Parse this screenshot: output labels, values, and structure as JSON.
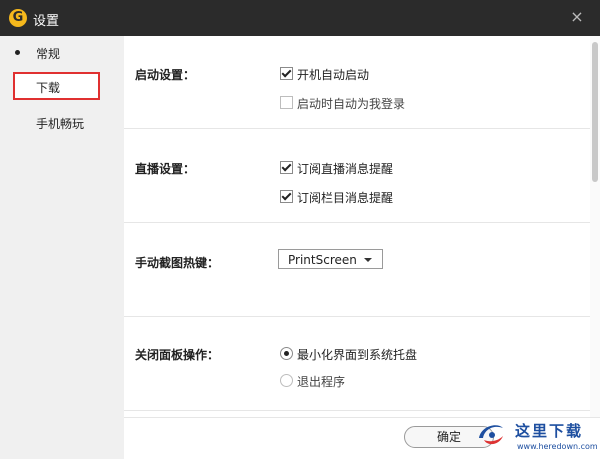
{
  "window": {
    "title": "设置",
    "logo": "G",
    "close_glyph": "×"
  },
  "sidebar": {
    "items": [
      {
        "label": "常规",
        "state": "current"
      },
      {
        "label": "下载",
        "state": "highlighted"
      },
      {
        "label": "手机畅玩",
        "state": "normal"
      }
    ]
  },
  "sections": {
    "startup": {
      "label": "启动设置：",
      "options": [
        {
          "label": "开机自动启动",
          "checked": true
        },
        {
          "label": "启动时自动为我登录",
          "checked": false
        }
      ]
    },
    "live": {
      "label": "直播设置：",
      "options": [
        {
          "label": "订阅直播消息提醒",
          "checked": true
        },
        {
          "label": "订阅栏目消息提醒",
          "checked": true
        }
      ]
    },
    "screenshot": {
      "label": "手动截图热键：",
      "hotkey": "PrintScreen"
    },
    "close_panel": {
      "label": "关闭面板操作：",
      "options": [
        {
          "label": "最小化界面到系统托盘",
          "selected": true
        },
        {
          "label": "退出程序",
          "selected": false
        }
      ]
    }
  },
  "footer": {
    "ok_label": "确定"
  },
  "watermark": {
    "text": "这里下载",
    "url": "www.heredown.com"
  },
  "colors": {
    "titlebar": "#2b2b2b",
    "accent_logo": "#f5b81c",
    "highlight_frame": "#e03030",
    "watermark": "#1e4fa0"
  }
}
